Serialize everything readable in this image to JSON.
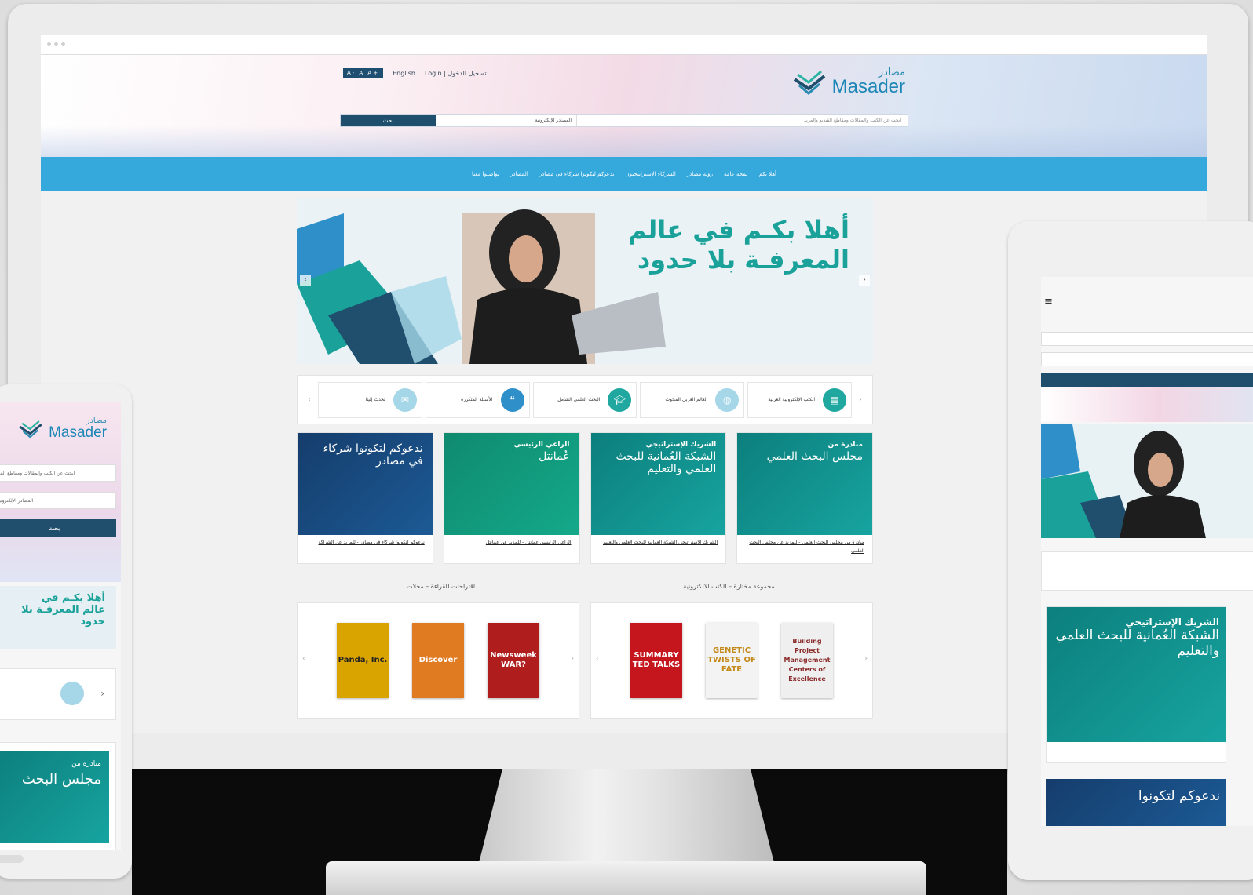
{
  "site": {
    "logo_ar": "مصادر",
    "logo_en": "Masader",
    "font_size_controls": "A- A A+",
    "lang_link": "English",
    "login_link": "Login | تسجيل الدخول"
  },
  "search": {
    "button": "بحث",
    "select_value": "المصادر الإلكترونية",
    "placeholder": "ابحث عن الكتب والمقالات ومقاطع الفيديو والمزيد"
  },
  "nav": [
    "أهلا بكم",
    "لمحة عامة",
    "رؤية مصادر",
    "الشركاء الإستراتيجيون",
    "ندعوكم لتكونوا شركاء في مصادر",
    "المصادر",
    "تواصلوا معنا"
  ],
  "hero": {
    "title_line1": "أهلا بكـم في عالم",
    "title_line2": "المعرفـة بلا حدود"
  },
  "quicklinks": [
    "تحدث إلينا",
    "الأسئلة المتكررة",
    "البحث العلمي الشامل",
    "العالم العربي المحوث",
    "الكتب الإلكترونية العربية"
  ],
  "cards": [
    {
      "small": "",
      "big": "ندعوكم لتكونوا شركاء في مصادر",
      "caption": "ندعوكم لتكونوا شركاء في مصادر - للمزيد عن الشراكة"
    },
    {
      "small": "الراعي الرئيسي",
      "big": "عُمانتل",
      "caption": "الراعي الرئيسي عمانتل - للمزيد عن عمانتل"
    },
    {
      "small": "الشريك الإستراتيجي",
      "big": "الشبكة العُمانية للبحث العلمي والتعليم",
      "caption": "الشريك الاستراتيجي الشبكة العمانية للبحث العلمي والتعليم"
    },
    {
      "small": "مبادرة من",
      "big": "مجلس البحث العلمي",
      "caption": "مبادرة من مجلس البحث العلمي - للمزيد عن مجلس البحث العلمي"
    }
  ],
  "sections": {
    "magazines": "اقتراحات للقراءة – مجلات",
    "ebooks": "مجموعة مختارة – الكتب الالكترونية"
  },
  "magazines": [
    {
      "title": "Panda, Inc.",
      "color": "#d9a400"
    },
    {
      "title": "Discover",
      "color": "#e07b22"
    },
    {
      "title": "Newsweek WAR?",
      "color": "#b01d1d"
    }
  ],
  "ebooks": [
    {
      "title": "SUMMARY TED TALKS",
      "color": "#c4161c"
    },
    {
      "title": "GENETIC TWISTS OF FATE",
      "color": "#f3f3f3"
    },
    {
      "title": "Building Project Management Centers of Excellence",
      "color": "#efefef"
    }
  ],
  "tablet": {
    "card_small": "الشريك الإستراتيجي",
    "card_big": "الشبكة العُمانية للبحث العلمي والتعليم",
    "card2": "ندعوكم لتكونوا"
  },
  "phone": {
    "placeholder": "ابحث عن الكتب والمقالات ومقاطع الفيديو",
    "select": "المصادر الإلكترونية ▾",
    "button": "بحث",
    "hero": "أهلا بكـم في عالم المعرفـة بلا حدود",
    "card_small": "مبادرة من",
    "card_big": "مجلس البحث"
  }
}
